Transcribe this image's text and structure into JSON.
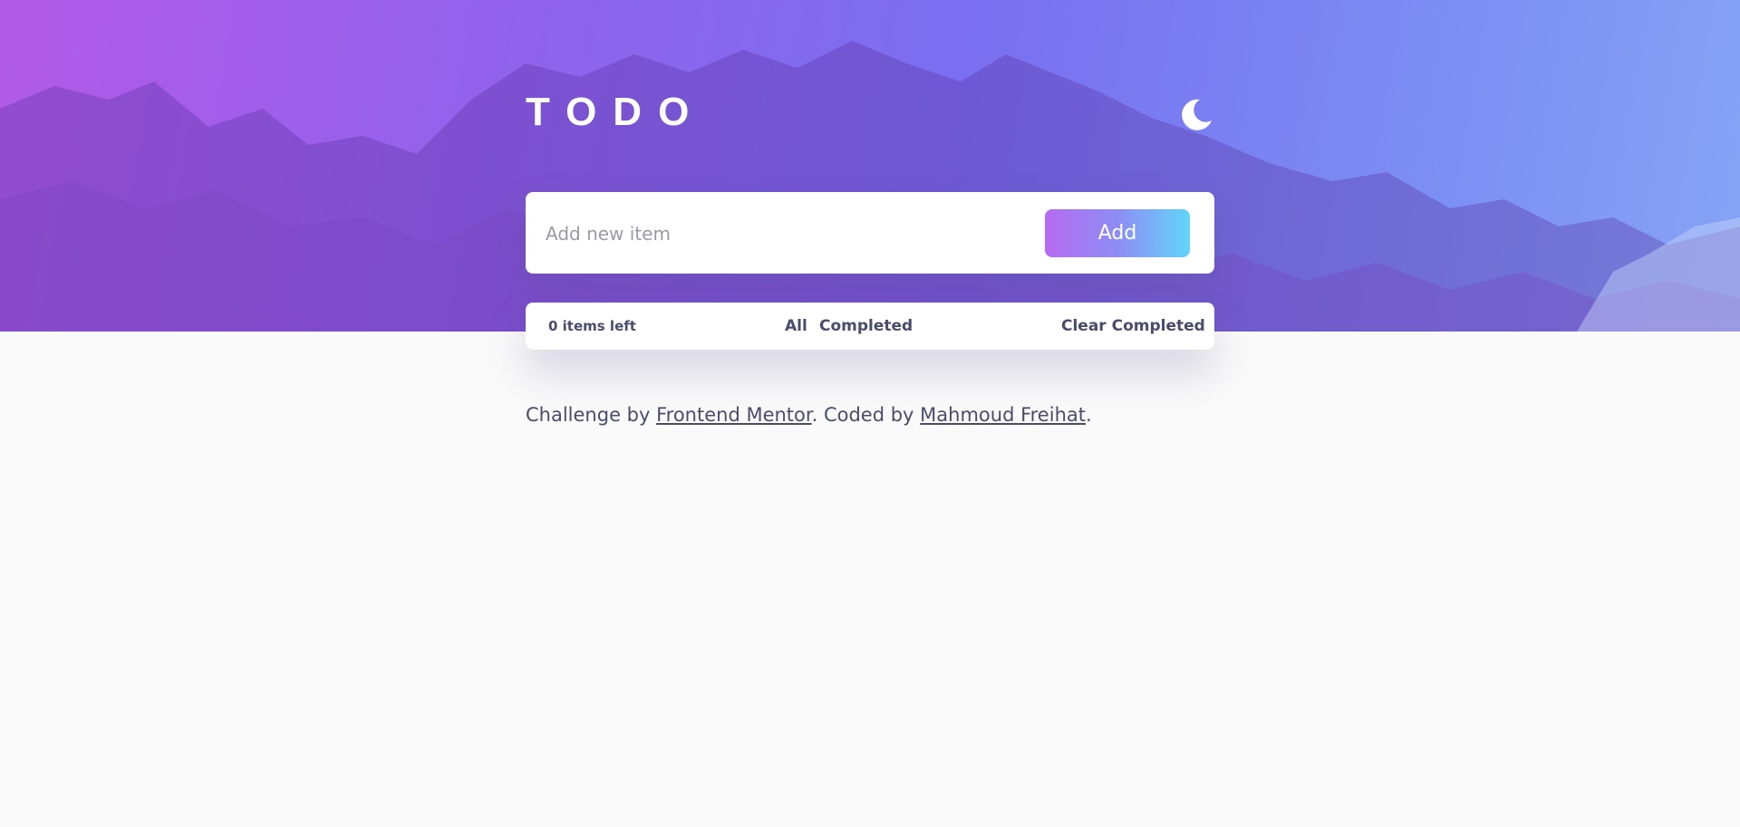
{
  "header": {
    "title": "TODO",
    "theme_toggle_icon": "moon-icon"
  },
  "new_item": {
    "placeholder": "Add new item",
    "value": "",
    "add_label": "Add"
  },
  "footer": {
    "items_left": "0 items left",
    "filters": [
      "All",
      "Completed"
    ],
    "clear_label": "Clear Completed"
  },
  "attribution": {
    "prefix": "Challenge by ",
    "challenge_link": "Frontend Mentor",
    "middle": ". Coded by ",
    "author_link": "Mahmoud Freihat",
    "suffix": "."
  },
  "colors": {
    "hero_gradient_start": "#b25ae8",
    "hero_gradient_end": "#86a4f5",
    "add_button_start": "#b66af0",
    "add_button_end": "#5fd6fb",
    "text": "#494c6b",
    "page_background": "#fafafa"
  }
}
